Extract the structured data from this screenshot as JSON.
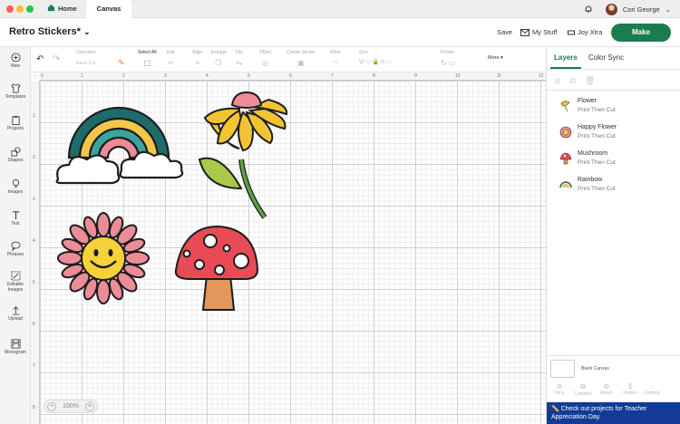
{
  "window": {
    "tabs": [
      {
        "label": "Home"
      },
      {
        "label": "Canvas"
      }
    ],
    "user": {
      "name": "Cori George"
    },
    "traffic_lights": [
      "#ff5f57",
      "#febc2e",
      "#28c840"
    ]
  },
  "header": {
    "project_title": "Retro Stickers*",
    "save_label": "Save",
    "mystuff_label": "My Stuff",
    "joy_label": "Joy Xtra",
    "make_label": "Make",
    "brand_color": "#1b7d4f"
  },
  "toolbar": {
    "operation_label": "Operation",
    "operation_value": "Basic Cut",
    "select_all": "Select All",
    "edit": "Edit",
    "align": "Align",
    "arrange": "Arrange",
    "flip": "Flip",
    "offset": "Offset",
    "warp": "Warp",
    "size": "Size",
    "rotate": "Rotate",
    "more": "More",
    "create_sticker": "Create Sticker"
  },
  "leftnav": {
    "items": [
      {
        "label": "New",
        "icon": "plus-circle-icon"
      },
      {
        "label": "Templates",
        "icon": "shirt-icon"
      },
      {
        "label": "Projects",
        "icon": "clipboard-icon"
      },
      {
        "label": "Shapes",
        "icon": "shapes-icon"
      },
      {
        "label": "Images",
        "icon": "lightbulb-icon"
      },
      {
        "label": "Text",
        "icon": "text-icon"
      },
      {
        "label": "Phrases",
        "icon": "speech-bubble-icon"
      },
      {
        "label": "Editable Images",
        "icon": "edit-image-icon"
      },
      {
        "label": "Upload",
        "icon": "upload-icon"
      },
      {
        "label": "Monogram",
        "icon": "monogram-icon"
      }
    ]
  },
  "canvas": {
    "zoom_label": "100%",
    "ruler_top": [
      "1",
      "2",
      "3",
      "4",
      "5",
      "6",
      "7",
      "8",
      "9",
      "10",
      "11",
      "12"
    ],
    "ruler_left": [
      "1",
      "2",
      "3",
      "4",
      "5",
      "6",
      "7",
      "8"
    ]
  },
  "right_panel": {
    "tab_layers": "Layers",
    "tab_color_sync": "Color Sync",
    "layers": [
      {
        "name": "Flower",
        "sub": "Print Then Cut",
        "icon": "flower-icon"
      },
      {
        "name": "Happy Flower",
        "sub": "Print Then Cut",
        "icon": "happy-flower-icon"
      },
      {
        "name": "Mushroom",
        "sub": "Print Then Cut",
        "icon": "mushroom-icon"
      },
      {
        "name": "Rainbow",
        "sub": "Print Then Cut",
        "icon": "rainbow-icon"
      }
    ],
    "blank_canvas_label": "Blank Canvas",
    "bottom_tools": [
      "Slice",
      "Combine",
      "Attach",
      "Flatten",
      "Contour"
    ],
    "banner_text": "✏️ Check out projects for Teacher Appreciation Day."
  }
}
